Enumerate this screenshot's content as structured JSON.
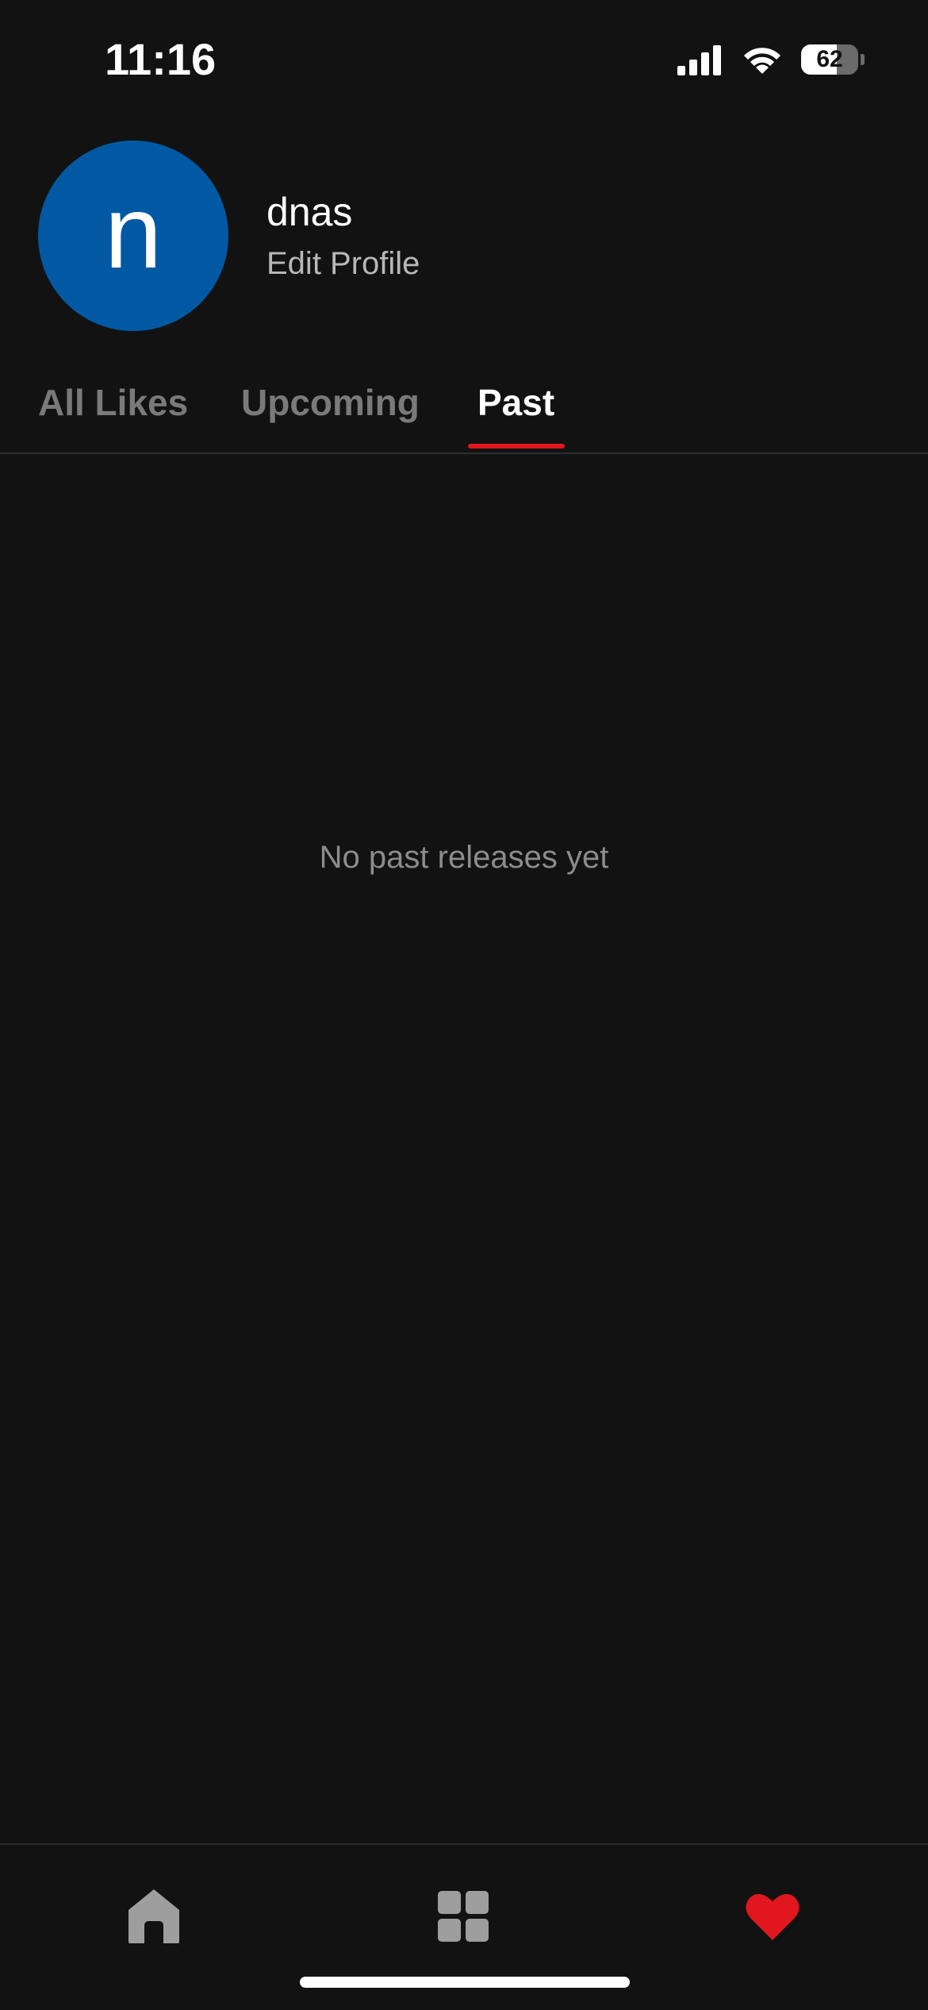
{
  "status_bar": {
    "time": "11:16",
    "battery_level": "62",
    "battery_fraction": 0.62
  },
  "profile": {
    "avatar_initial": "n",
    "avatar_color": "#0159a3",
    "username": "dnas",
    "edit_label": "Edit Profile"
  },
  "tabs": [
    {
      "label": "All Likes",
      "active": false
    },
    {
      "label": "Upcoming",
      "active": false
    },
    {
      "label": "Past",
      "active": true
    }
  ],
  "accent_color": "#e1161f",
  "empty_state": {
    "message": "No past releases yet"
  },
  "bottom_nav": {
    "items": [
      {
        "icon": "home-icon",
        "active": false
      },
      {
        "icon": "grid-icon",
        "active": false
      },
      {
        "icon": "heart-icon",
        "active": true
      }
    ]
  }
}
